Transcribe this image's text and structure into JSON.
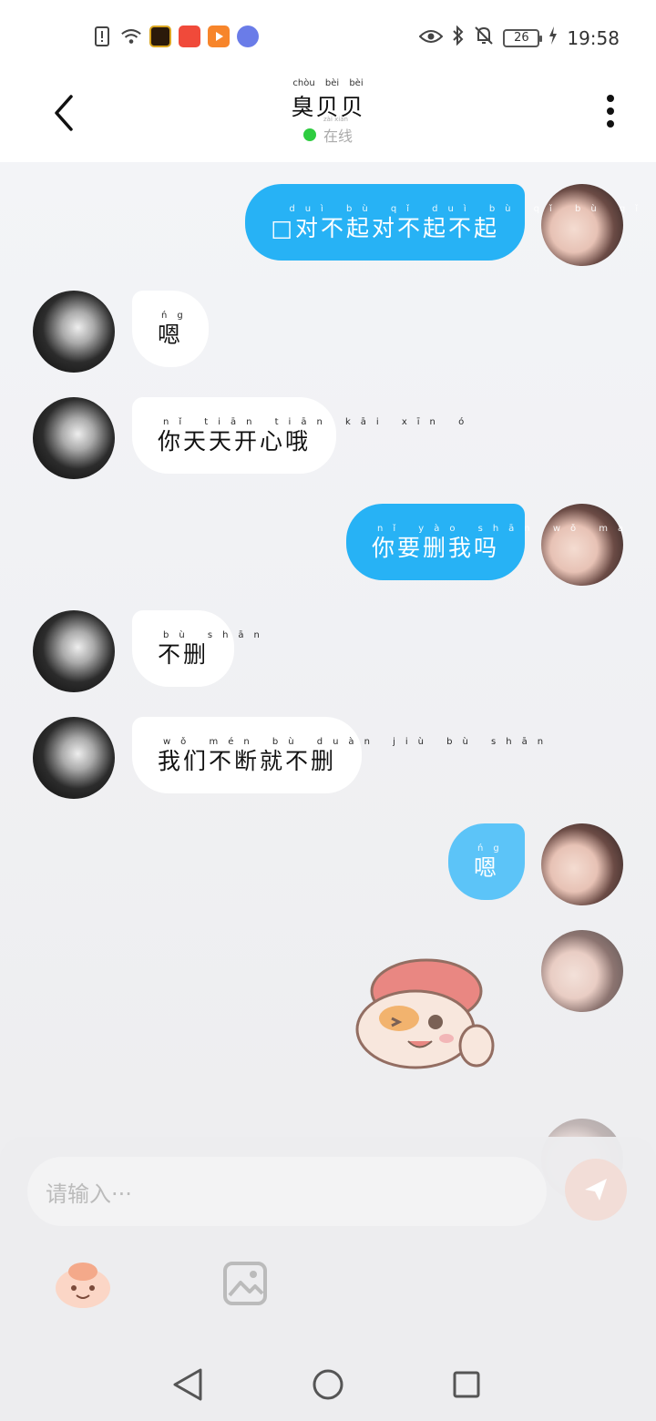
{
  "status_bar": {
    "time": "19:58",
    "battery": "26",
    "left_icons": [
      "alert-icon",
      "wifi-icon",
      "game-app-icon",
      "shopping-app-icon",
      "video-app-icon",
      "music-app-icon"
    ],
    "right_icons": [
      "eye-icon",
      "bluetooth-icon",
      "mute-icon",
      "battery-icon",
      "charging-icon"
    ]
  },
  "header": {
    "title": "臭贝贝",
    "title_pinyin": "chòu bèi bèi",
    "status_text": "在线",
    "status_pinyin": "zài xiàn",
    "status_color": "#2ecc40"
  },
  "messages": [
    {
      "side": "out",
      "text": "对不起对不起不起",
      "prefix": "□",
      "pinyin": "duì bù qǐ duì bù qǐ bù qǐ"
    },
    {
      "side": "in",
      "text": "嗯",
      "pinyin": "ńg"
    },
    {
      "side": "in",
      "text": "你天天开心哦",
      "pinyin": "nǐ tiān tiān kāi xīn ó"
    },
    {
      "side": "out",
      "text": "你要删我吗",
      "pinyin": "nǐ yào shān wǒ ma"
    },
    {
      "side": "in",
      "text": "不删",
      "pinyin": "bù shān"
    },
    {
      "side": "in",
      "text": "我们不断就不删",
      "pinyin": "wǒ mén bù duàn jiù bù shān"
    },
    {
      "side": "out",
      "text": "嗯",
      "pinyin": "ńg"
    }
  ],
  "input": {
    "placeholder": "请输入···"
  },
  "colors": {
    "outgoing_bubble": "#27b2f5",
    "incoming_bubble": "#ffffff",
    "background": "#f3f4f7"
  },
  "toolbar_icons": [
    "emoji-icon",
    "image-icon",
    "send-icon"
  ],
  "nav_icons": [
    "nav-back-icon",
    "nav-home-icon",
    "nav-recent-icon"
  ]
}
